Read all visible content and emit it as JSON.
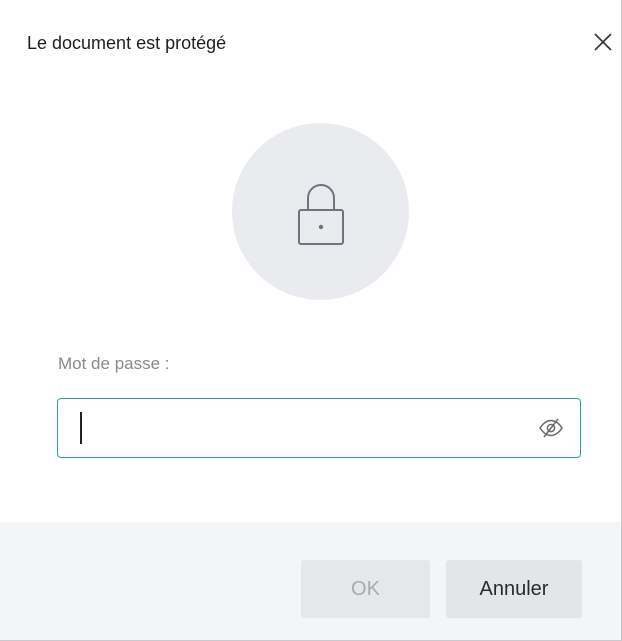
{
  "dialog": {
    "title": "Le document est protégé",
    "close_icon": "close-icon",
    "lock_icon": "lock-icon"
  },
  "password": {
    "label": "Mot de passe :",
    "value": "",
    "placeholder": "",
    "toggle_icon": "eye-hidden-icon"
  },
  "buttons": {
    "ok_label": "OK",
    "cancel_label": "Annuler"
  },
  "colors": {
    "accent": "#2aa39a",
    "footer_bg": "#f4f5f7",
    "lock_circle": "#e9ebee"
  }
}
